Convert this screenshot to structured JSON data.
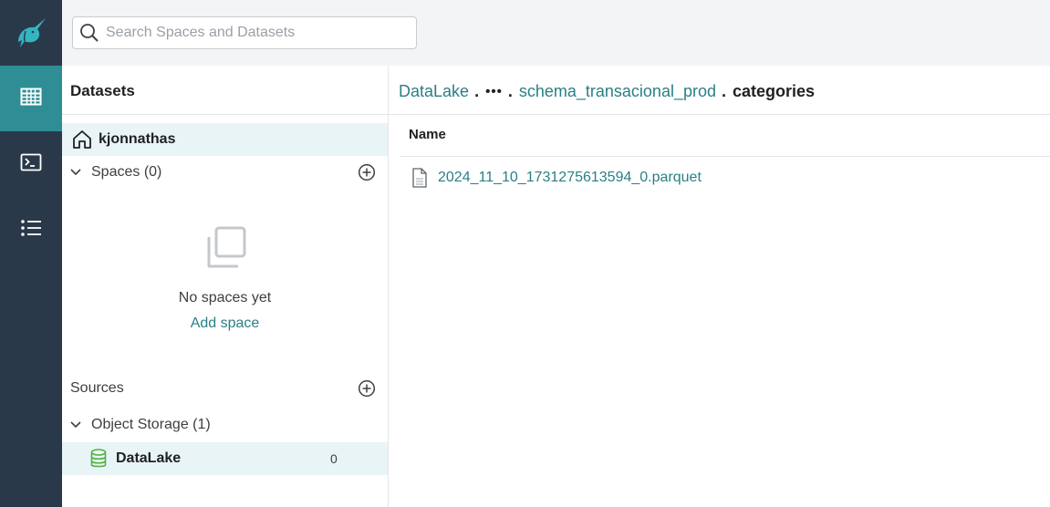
{
  "app": {
    "logo_icon": "narwhal-logo-icon",
    "accent_color": "#2f8e95",
    "rail_color": "#2a394a"
  },
  "nav": {
    "items": [
      {
        "name": "datasets",
        "icon": "grid-table-icon",
        "active": true
      },
      {
        "name": "sql-runner",
        "icon": "terminal-icon",
        "active": false
      },
      {
        "name": "jobs",
        "icon": "list-icon",
        "active": false
      }
    ]
  },
  "search": {
    "placeholder": "Search Spaces and Datasets",
    "value": ""
  },
  "sidebar": {
    "title": "Datasets",
    "home_label": "kjonnathas",
    "spaces_label": "Spaces (0)",
    "empty_message": "No spaces yet",
    "add_space_label": "Add space",
    "sources_label": "Sources",
    "object_storage_label": "Object Storage (1)",
    "source_item": {
      "label": "DataLake",
      "count": "0"
    }
  },
  "breadcrumb": {
    "root": "DataLake",
    "sep": ".",
    "ellipsis": "•••",
    "schema": "schema_transacional_prod",
    "current": "categories"
  },
  "table": {
    "column_name": "Name",
    "rows": [
      {
        "name": "2024_11_10_1731275613594_0.parquet",
        "icon": "file-icon"
      }
    ]
  }
}
